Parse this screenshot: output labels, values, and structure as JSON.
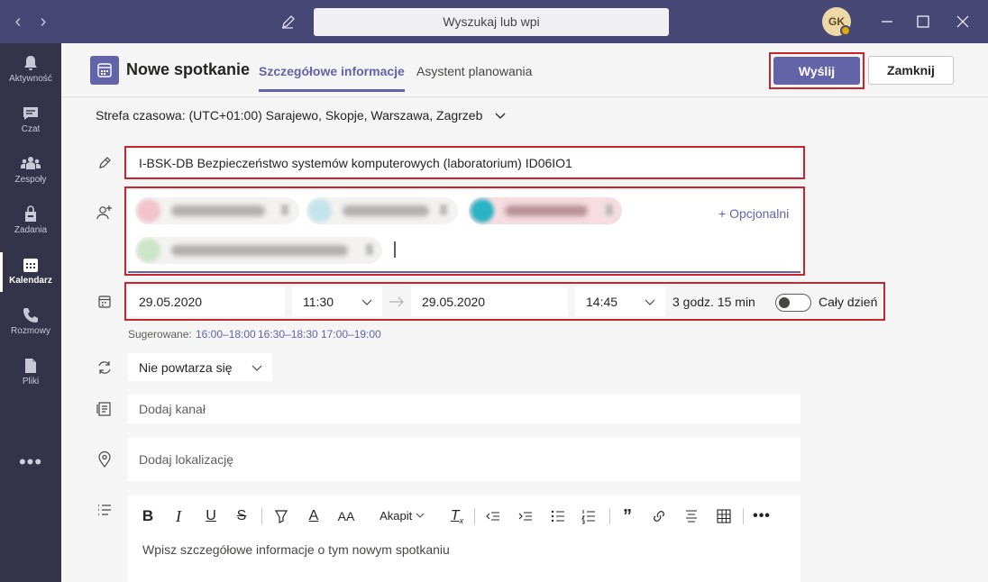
{
  "titlebar": {
    "search_placeholder": "Wyszukaj lub wpi",
    "avatar_initials": "GK"
  },
  "rail": {
    "items": [
      {
        "label": "Aktywność",
        "icon": "bell-icon"
      },
      {
        "label": "Czat",
        "icon": "chat-icon"
      },
      {
        "label": "Zespoły",
        "icon": "teams-icon"
      },
      {
        "label": "Zadania",
        "icon": "assignments-icon"
      },
      {
        "label": "Kalendarz",
        "icon": "calendar-icon",
        "active": true
      },
      {
        "label": "Rozmowy",
        "icon": "phone-icon"
      },
      {
        "label": "Pliki",
        "icon": "file-icon"
      }
    ],
    "more": "•••"
  },
  "header": {
    "title": "Nowe spotkanie",
    "tabs": [
      {
        "label": "Szczegółowe informacje",
        "active": true
      },
      {
        "label": "Asystent planowania",
        "active": false
      }
    ],
    "send_label": "Wyślij",
    "close_label": "Zamknij"
  },
  "timezone": {
    "label": "Strefa czasowa: (UTC+01:00) Sarajewo, Skopje, Warszawa, Zagrzeb"
  },
  "form": {
    "title_value": "I-BSK-DB Bezpieczeństwo systemów komputerowych (laboratorium) ID06IO1",
    "optional_label": "+ Opcjonalni",
    "start_date": "29.05.2020",
    "start_time": "11:30",
    "end_date": "29.05.2020",
    "end_time": "14:45",
    "duration": "3 godz. 15 min",
    "all_day_label": "Cały dzień",
    "all_day_on": false,
    "suggested_label": "Sugerowane:",
    "suggested_slots": [
      "16:00–18:00",
      "16:30–18:30",
      "17:00–19:00"
    ],
    "repeat": "Nie powtarza się",
    "channel_placeholder": "Dodaj kanał",
    "location_placeholder": "Dodaj lokalizację"
  },
  "editor": {
    "paragraph_label": "Akapit",
    "placeholder": "Wpisz szczegółowe informacje o tym nowym spotkaniu"
  },
  "colors": {
    "brand": "#6264a7",
    "titlebar": "#464775",
    "rail": "#33344a",
    "highlight": "#c4262e"
  }
}
